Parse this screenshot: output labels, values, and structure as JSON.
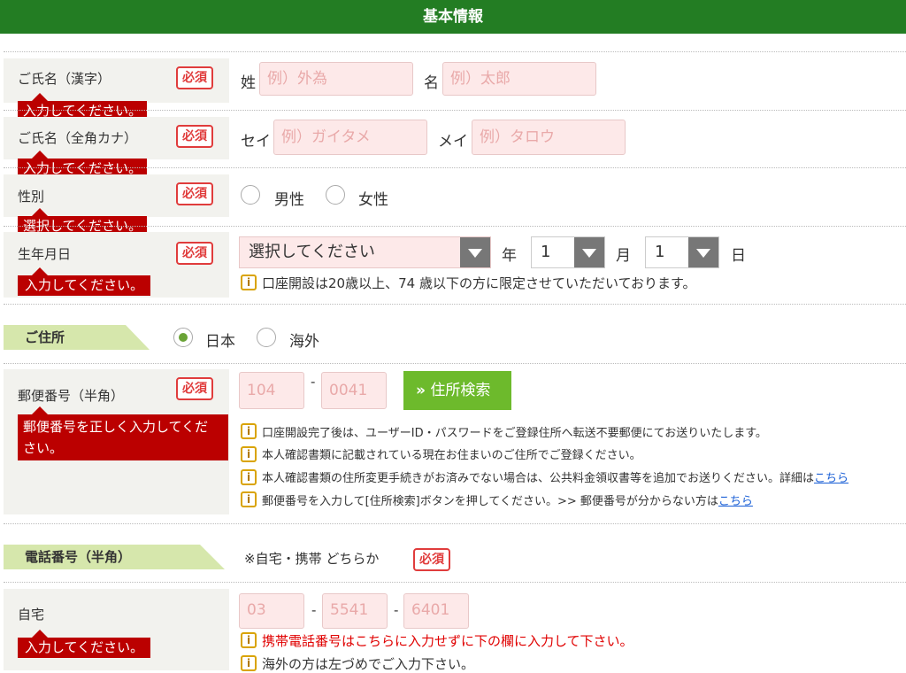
{
  "header": {
    "title": "基本情報"
  },
  "required_label": "必須",
  "name_kanji": {
    "label": "ご氏名（漢字）",
    "last_prefix": "姓",
    "last_placeholder": "例）外為",
    "first_prefix": "名",
    "first_placeholder": "例）太郎",
    "error": "入力してください。"
  },
  "name_kana": {
    "label": "ご氏名（全角カナ）",
    "last_prefix": "セイ",
    "last_placeholder": "例）ガイタメ",
    "first_prefix": "メイ",
    "first_placeholder": "例）タロウ",
    "error": "入力してください。"
  },
  "gender": {
    "label": "性別",
    "options": [
      "男性",
      "女性"
    ],
    "error": "選択してください。"
  },
  "birthdate": {
    "label": "生年月日",
    "year_value": "選択してください",
    "year_unit": "年",
    "month_value": "1",
    "month_unit": "月",
    "day_value": "1",
    "day_unit": "日",
    "note": "口座開設は20歳以上、74 歳以下の方に限定させていただいております。",
    "error": "入力してください。"
  },
  "address": {
    "section_label": "ご住所",
    "options": [
      "日本",
      "海外"
    ],
    "selected": "日本"
  },
  "postal": {
    "label": "郵便番号（半角）",
    "placeholder1": "104",
    "separator": "-",
    "placeholder2": "0041",
    "search_button": "住所検索",
    "search_chevron": "»",
    "error_line1": "郵便番号を正しく入力してくだ",
    "error_line2": "さい。",
    "notes": [
      {
        "text": "口座開設完了後は、ユーザーID・パスワードをご登録住所へ転送不要郵便にてお送りいたします。"
      },
      {
        "text": "本人確認書類に記載されている現在お住まいのご住所でご登録ください。"
      },
      {
        "text": "本人確認書類の住所変更手続きがお済みでない場合は、公共料金領収書等を追加でお送りください。詳細は",
        "link": "こちら"
      },
      {
        "text": "郵便番号を入力して[住所検索]ボタンを押してください。>> 郵便番号が分からない方は",
        "link": "こちら"
      }
    ]
  },
  "phone": {
    "section_label": "電話番号（半角）",
    "note": "※自宅・携帯 どちらか"
  },
  "home_phone": {
    "label": "自宅",
    "placeholder1": "03",
    "placeholder2": "5541",
    "placeholder3": "6401",
    "separator": "-",
    "error": "入力してください。",
    "note_red": "携帯電話番号はこちらに入力せずに下の欄に入力して下さい。",
    "note2": "海外の方は左づめでご入力下さい。"
  },
  "info_icon_char": "i",
  "colors": {
    "header_bg": "#237d23",
    "error_bg": "#bb0000",
    "required_border": "#e03c3c",
    "input_bg": "#fde9e9",
    "button_bg": "#6dba2c",
    "section_bg": "#d6e7ac"
  }
}
